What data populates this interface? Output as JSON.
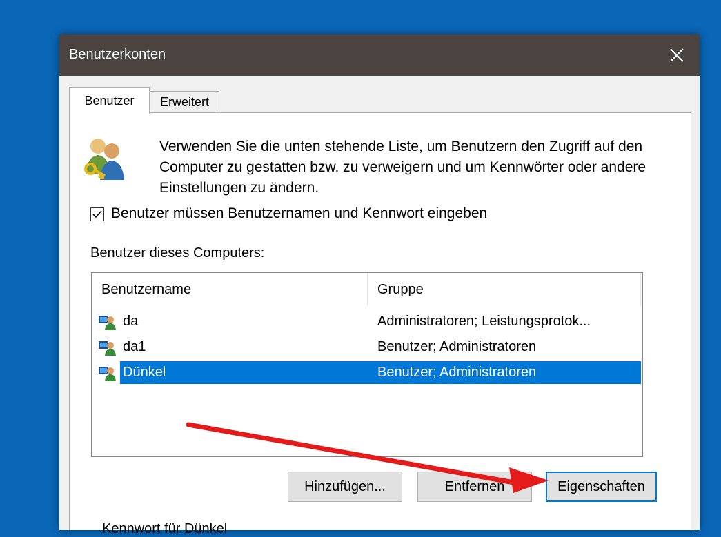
{
  "window": {
    "title": "Benutzerkonten",
    "close_icon": "close-icon"
  },
  "tabs": [
    {
      "label": "Benutzer",
      "active": true
    },
    {
      "label": "Erweitert",
      "active": false
    }
  ],
  "intro": {
    "icon": "users-key-icon",
    "text": "Verwenden Sie die unten stehende Liste, um Benutzern den Zugriff auf den Computer zu gestatten bzw. zu verweigern und um Kennwörter oder andere Einstellungen zu ändern."
  },
  "require_login": {
    "label": "Benutzer müssen Benutzernamen und Kennwort eingeben",
    "checked": true
  },
  "users_list": {
    "label": "Benutzer dieses Computers:",
    "columns": [
      "Benutzername",
      "Gruppe"
    ],
    "rows": [
      {
        "name": "da",
        "group": "Administratoren; Leistungsprotok...",
        "selected": false
      },
      {
        "name": "da1",
        "group": "Benutzer; Administratoren",
        "selected": false
      },
      {
        "name": "Dünkel",
        "group": "Benutzer; Administratoren",
        "selected": true
      }
    ]
  },
  "buttons": {
    "add": "Hinzufügen...",
    "remove": "Entfernen",
    "properties": "Eigenschaften"
  },
  "password_section": {
    "label": "Kennwort für Dünkel"
  },
  "colors": {
    "desktop": "#0a66b6",
    "titlebar": "#4a433f",
    "selection": "#0078d7",
    "annotation_arrow": "#e31b1b"
  }
}
